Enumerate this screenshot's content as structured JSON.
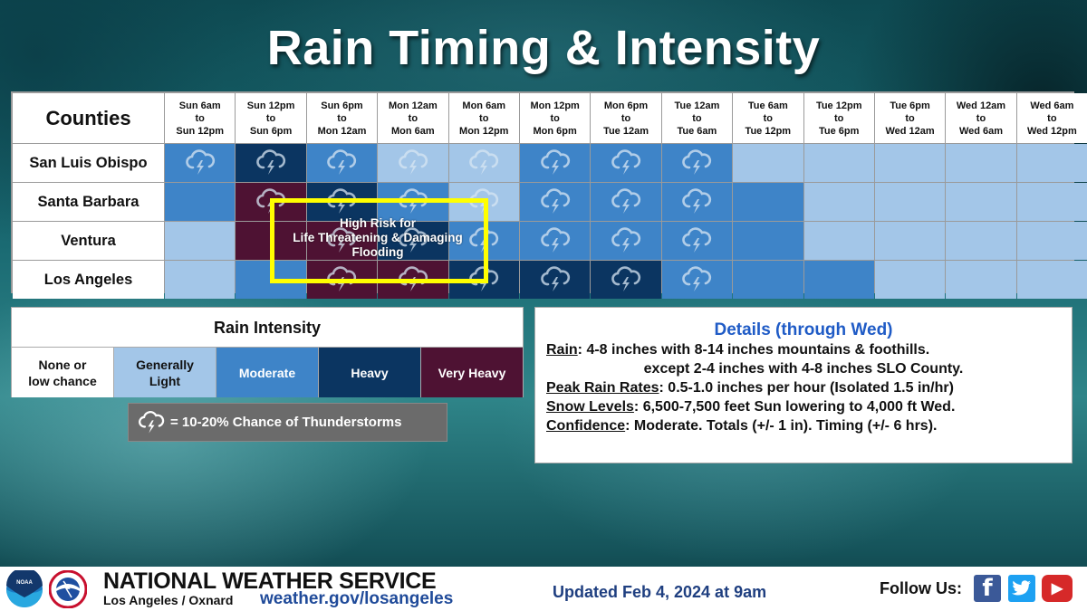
{
  "title": "Rain Timing & Intensity",
  "grid": {
    "corner_label": "Counties",
    "columns": [
      {
        "line1": "Sun 6am",
        "line2": "to",
        "line3": "Sun 12pm"
      },
      {
        "line1": "Sun 12pm",
        "line2": "to",
        "line3": "Sun 6pm"
      },
      {
        "line1": "Sun 6pm",
        "line2": "to",
        "line3": "Mon 12am"
      },
      {
        "line1": "Mon 12am",
        "line2": "to",
        "line3": "Mon 6am"
      },
      {
        "line1": "Mon 6am",
        "line2": "to",
        "line3": "Mon 12pm"
      },
      {
        "line1": "Mon 12pm",
        "line2": "to",
        "line3": "Mon 6pm"
      },
      {
        "line1": "Mon 6pm",
        "line2": "to",
        "line3": "Tue 12am"
      },
      {
        "line1": "Tue 12am",
        "line2": "to",
        "line3": "Tue 6am"
      },
      {
        "line1": "Tue 6am",
        "line2": "to",
        "line3": "Tue 12pm"
      },
      {
        "line1": "Tue 12pm",
        "line2": "to",
        "line3": "Tue 6pm"
      },
      {
        "line1": "Tue 6pm",
        "line2": "to",
        "line3": "Wed 12am"
      },
      {
        "line1": "Wed 12am",
        "line2": "to",
        "line3": "Wed 6am"
      },
      {
        "line1": "Wed 6am",
        "line2": "to",
        "line3": "Wed 12pm"
      }
    ],
    "rows": [
      {
        "county": "San Luis Obispo",
        "intensity": [
          "moderate",
          "heavy",
          "moderate",
          "light",
          "light",
          "moderate",
          "moderate",
          "moderate",
          "light",
          "light",
          "light",
          "light",
          "light"
        ],
        "thunder": [
          true,
          true,
          true,
          true,
          true,
          true,
          true,
          true,
          false,
          false,
          false,
          false,
          false
        ]
      },
      {
        "county": "Santa Barbara",
        "intensity": [
          "moderate",
          "veryheavy",
          "heavy",
          "moderate",
          "light",
          "moderate",
          "moderate",
          "moderate",
          "moderate",
          "light",
          "light",
          "light",
          "light"
        ],
        "thunder": [
          false,
          true,
          true,
          true,
          true,
          true,
          true,
          true,
          false,
          false,
          false,
          false,
          false
        ]
      },
      {
        "county": "Ventura",
        "intensity": [
          "light",
          "veryheavy",
          "veryheavy",
          "heavy",
          "moderate",
          "moderate",
          "moderate",
          "moderate",
          "moderate",
          "light",
          "light",
          "light",
          "light"
        ],
        "thunder": [
          false,
          false,
          true,
          true,
          true,
          true,
          true,
          true,
          false,
          false,
          false,
          false,
          false
        ]
      },
      {
        "county": "Los Angeles",
        "intensity": [
          "light",
          "moderate",
          "veryheavy",
          "veryheavy",
          "heavy",
          "heavy",
          "heavy",
          "moderate",
          "moderate",
          "moderate",
          "light",
          "light",
          "light"
        ],
        "thunder": [
          false,
          false,
          true,
          true,
          true,
          true,
          true,
          true,
          false,
          false,
          false,
          false,
          false
        ]
      }
    ],
    "risk_annotation": {
      "line1": "High Risk for",
      "line2": "Life Threatening & Damaging",
      "line3": "Flooding",
      "border_color": "#ffff00"
    }
  },
  "legend": {
    "title": "Rain Intensity",
    "levels": [
      {
        "key": "none",
        "line1": "None or",
        "line2": "low chance",
        "color": "#ffffff"
      },
      {
        "key": "light",
        "line1": "Generally",
        "line2": "Light",
        "color": "#a3c6e8"
      },
      {
        "key": "moderate",
        "line1": "Moderate",
        "line2": "",
        "color": "#3e84c8"
      },
      {
        "key": "heavy",
        "line1": "Heavy",
        "line2": "",
        "color": "#0b3561"
      },
      {
        "key": "veryheavy",
        "line1": "Very Heavy",
        "line2": "",
        "color": "#4e1233"
      }
    ],
    "thunder_icon": "thunderstorm-cloud-icon",
    "thunder_text": "=  10-20% Chance of Thunderstorms"
  },
  "details": {
    "title": "Details (through Wed)",
    "lines": [
      {
        "label": "Rain",
        "text": ": 4-8 inches with 8-14 inches mountains & foothills."
      },
      {
        "label": "",
        "text": "except 2-4 inches with 4-8 inches SLO County."
      },
      {
        "label": "Peak Rain Rates",
        "text": ": 0.5-1.0 inches per hour (Isolated 1.5 in/hr)"
      },
      {
        "label": "Snow Levels",
        "text": ": 6,500-7,500 feet Sun lowering to 4,000 ft Wed."
      },
      {
        "label": "Confidence",
        "text": ": Moderate. Totals (+/- 1 in). Timing (+/- 6 hrs)."
      }
    ]
  },
  "footer": {
    "org_name": "NATIONAL WEATHER SERVICE",
    "office": "Los Angeles / Oxnard",
    "url": "weather.gov/losangeles",
    "updated": "Updated Feb 4, 2024 at 9am",
    "follow_label": "Follow Us:",
    "social": [
      {
        "name": "facebook",
        "glyph": "f"
      },
      {
        "name": "twitter",
        "glyph": "bird"
      },
      {
        "name": "youtube",
        "glyph": "▶"
      }
    ],
    "logos": [
      "noaa-logo",
      "nws-logo"
    ]
  }
}
